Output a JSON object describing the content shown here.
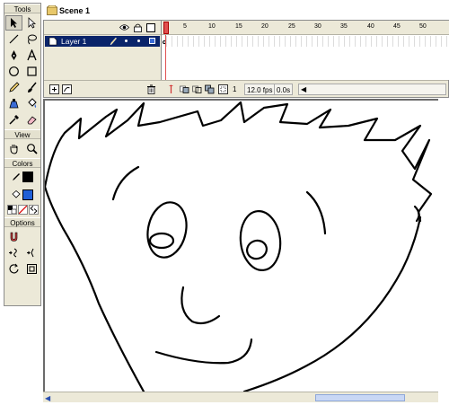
{
  "tools_panel": {
    "title": "Tools",
    "view_title": "View",
    "colors_title": "Colors",
    "options_title": "Options"
  },
  "scene": {
    "label": "Scene 1"
  },
  "timeline": {
    "layer_name": "Layer 1",
    "ruler_ticks": [
      "5",
      "10",
      "15",
      "20",
      "25",
      "30",
      "35",
      "40",
      "45",
      "50"
    ],
    "current_frame": "1",
    "frame_rate": "12.0 fps",
    "elapsed_time": "0.0s"
  },
  "colors": {
    "stroke": "#000000",
    "fill": "#1f5fd6",
    "panel_bg": "#ece9d8",
    "selected_layer": "#0a246a",
    "playhead": "#e05050"
  }
}
